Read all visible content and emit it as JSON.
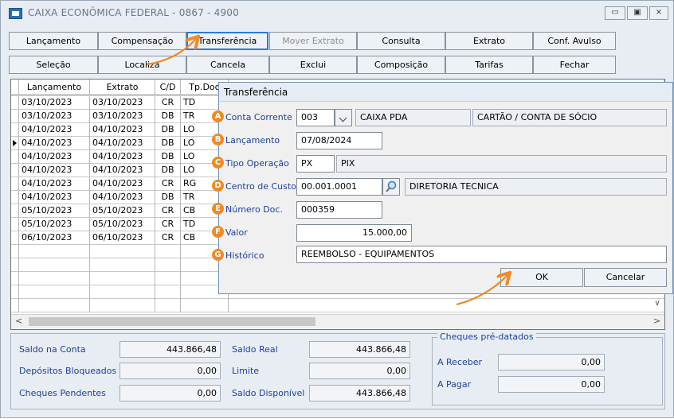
{
  "window": {
    "title": "CAIXA ECONÔMICA FEDERAL - 0867 - 4900",
    "controls": {
      "minimize": "▭",
      "maximize": "▣",
      "close": "⨯"
    }
  },
  "toolbar": {
    "row1": [
      "Lançamento",
      "Compensação",
      "Transferência",
      "Mover Extrato",
      "Consulta",
      "Extrato",
      "Conf. Avulso"
    ],
    "row2": [
      "Seleção",
      "Localiza",
      "Cancela",
      "Exclui",
      "Composição",
      "Tarifas",
      "Fechar"
    ]
  },
  "grid": {
    "columns": [
      "Lançamento",
      "Extrato",
      "C/D",
      "Tp.Doc"
    ],
    "rows": [
      [
        "03/10/2023",
        "03/10/2023",
        "CR",
        "TD"
      ],
      [
        "03/10/2023",
        "03/10/2023",
        "DB",
        "TR"
      ],
      [
        "04/10/2023",
        "04/10/2023",
        "DB",
        "LO"
      ],
      [
        "04/10/2023",
        "04/10/2023",
        "DB",
        "LO"
      ],
      [
        "04/10/2023",
        "04/10/2023",
        "DB",
        "LO"
      ],
      [
        "04/10/2023",
        "04/10/2023",
        "DB",
        "LO"
      ],
      [
        "04/10/2023",
        "04/10/2023",
        "CR",
        "RG"
      ],
      [
        "04/10/2023",
        "04/10/2023",
        "DB",
        "TR"
      ],
      [
        "05/10/2023",
        "05/10/2023",
        "CR",
        "CB"
      ],
      [
        "05/10/2023",
        "05/10/2023",
        "CR",
        "TD"
      ],
      [
        "06/10/2023",
        "06/10/2023",
        "CR",
        "CB"
      ]
    ],
    "current_row": 3
  },
  "totals": {
    "saldo_conta_label": "Saldo na Conta",
    "saldo_conta": "443.866,48",
    "depositos_label": "Depósitos Bloqueados",
    "depositos": "0,00",
    "cheques_label": "Cheques Pendentes",
    "cheques": "0,00",
    "saldo_real_label": "Saldo Real",
    "saldo_real": "443.866,48",
    "limite_label": "Limite",
    "limite": "0,00",
    "saldo_disp_label": "Saldo Disponível",
    "saldo_disp": "443.866,48"
  },
  "predatados": {
    "title": "Cheques pré-datados",
    "receber_label": "A Receber",
    "receber": "0,00",
    "pagar_label": "A Pagar",
    "pagar": "0,00"
  },
  "dialog": {
    "title": "Transferência",
    "badges": [
      "A",
      "B",
      "C",
      "D",
      "E",
      "F",
      "G"
    ],
    "conta_corrente_label": "Conta Corrente",
    "conta_codigo": "003",
    "conta_nome": "CAIXA PDA",
    "conta_tipo": "CARTÃO / CONTA DE SÓCIO",
    "lancamento_label": "Lançamento",
    "lancamento": "07/08/2024",
    "tipo_operacao_label": "Tipo Operação",
    "tipo_codigo": "PX",
    "tipo_nome": "PIX",
    "centro_custo_label": "Centro de Custo",
    "centro_codigo": "00.001.0001",
    "centro_nome": "DIRETORIA TECNICA",
    "numero_doc_label": "Número Doc.",
    "numero_doc": "000359",
    "valor_label": "Valor",
    "valor": "15.000,00",
    "historico_label": "Histórico",
    "historico": "REEMBOLSO - EQUIPAMENTOS",
    "ok": "OK",
    "cancelar": "Cancelar"
  },
  "colors": {
    "accent": "#2f7ad1",
    "badge": "#f08a24",
    "label": "#1e3f9a",
    "annotation": "#f08a24"
  }
}
